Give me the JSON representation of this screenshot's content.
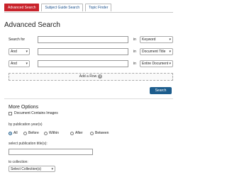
{
  "tabs": [
    "Advanced Search",
    "Subject Guide Search",
    "Topic Finder"
  ],
  "heading": "Advanced Search",
  "rows": [
    {
      "label": "Search for",
      "operator": "",
      "in_label": "in",
      "field": "Keyword",
      "value": ""
    },
    {
      "label": "",
      "operator": "And",
      "in_label": "in",
      "field": "Document Title",
      "value": ""
    },
    {
      "label": "",
      "operator": "And",
      "in_label": "in",
      "field": "Entire Document",
      "value": ""
    }
  ],
  "add_row_label": "Add a Row",
  "search_button": "Search",
  "more_options": {
    "title": "More Options",
    "contains_images": "Document Contains Images",
    "pub_year_label": "by publication year(s)",
    "pub_year_options": [
      "All",
      "Before",
      "Within",
      "After",
      "Between"
    ],
    "pub_year_selected": "All",
    "pub_title_label": "select publication title(s):",
    "pub_title_value": "",
    "collection_label": "to collection:",
    "collection_value": "Select Collection(s)"
  },
  "colors": {
    "accent_red": "#c9232b",
    "button_blue": "#1d5d8d"
  },
  "icons": {
    "dropdown": "chevron-down-icon",
    "add": "plus-circle-icon"
  }
}
